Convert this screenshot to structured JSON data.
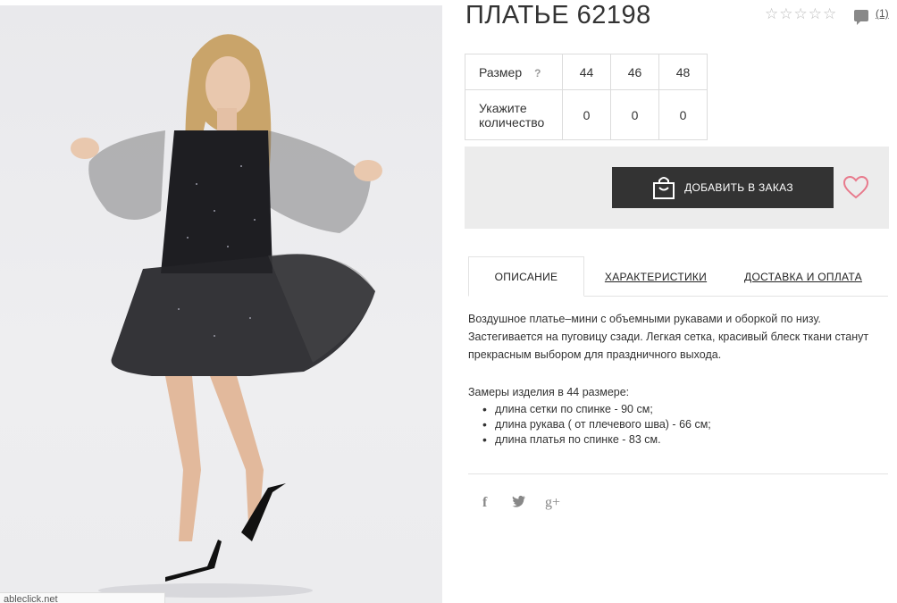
{
  "product": {
    "title": "ПЛАТЬЕ 62198",
    "stars": "☆☆☆☆☆",
    "comment_count": "(1)"
  },
  "sizes": {
    "label_size": "Размер",
    "help": "?",
    "values": [
      "44",
      "46",
      "48"
    ],
    "label_qty": "Укажите количество",
    "qty": [
      "0",
      "0",
      "0"
    ]
  },
  "order": {
    "add_label": "ДОБАВИТЬ В ЗАКАЗ"
  },
  "tabs": [
    "ОПИСАНИЕ",
    "ХАРАКТЕРИСТИКИ",
    "ДОСТАВКА И ОПЛАТА"
  ],
  "description": {
    "text": "Воздушное платье–мини с объемными рукавами и оборкой по низу. Застегивается на пуговицу сзади. Легкая сетка, красивый блеск ткани станут прекрасным выбором для праздничного выхода.",
    "measure_title": "Замеры изделия в 44 размере:",
    "measures": [
      "длина сетки по спинке - 90 см;",
      "длина рукава ( от плечевого шва) - 66 см;",
      "длина платья по спинке - 83 см."
    ]
  },
  "image": {
    "url_text": "ableclick.net"
  },
  "social": {
    "facebook": "f",
    "twitter": "t",
    "google": "g+"
  },
  "colors": {
    "button_bg": "#333333",
    "heart": "#e87a8c",
    "order_box_bg": "#ececec"
  }
}
